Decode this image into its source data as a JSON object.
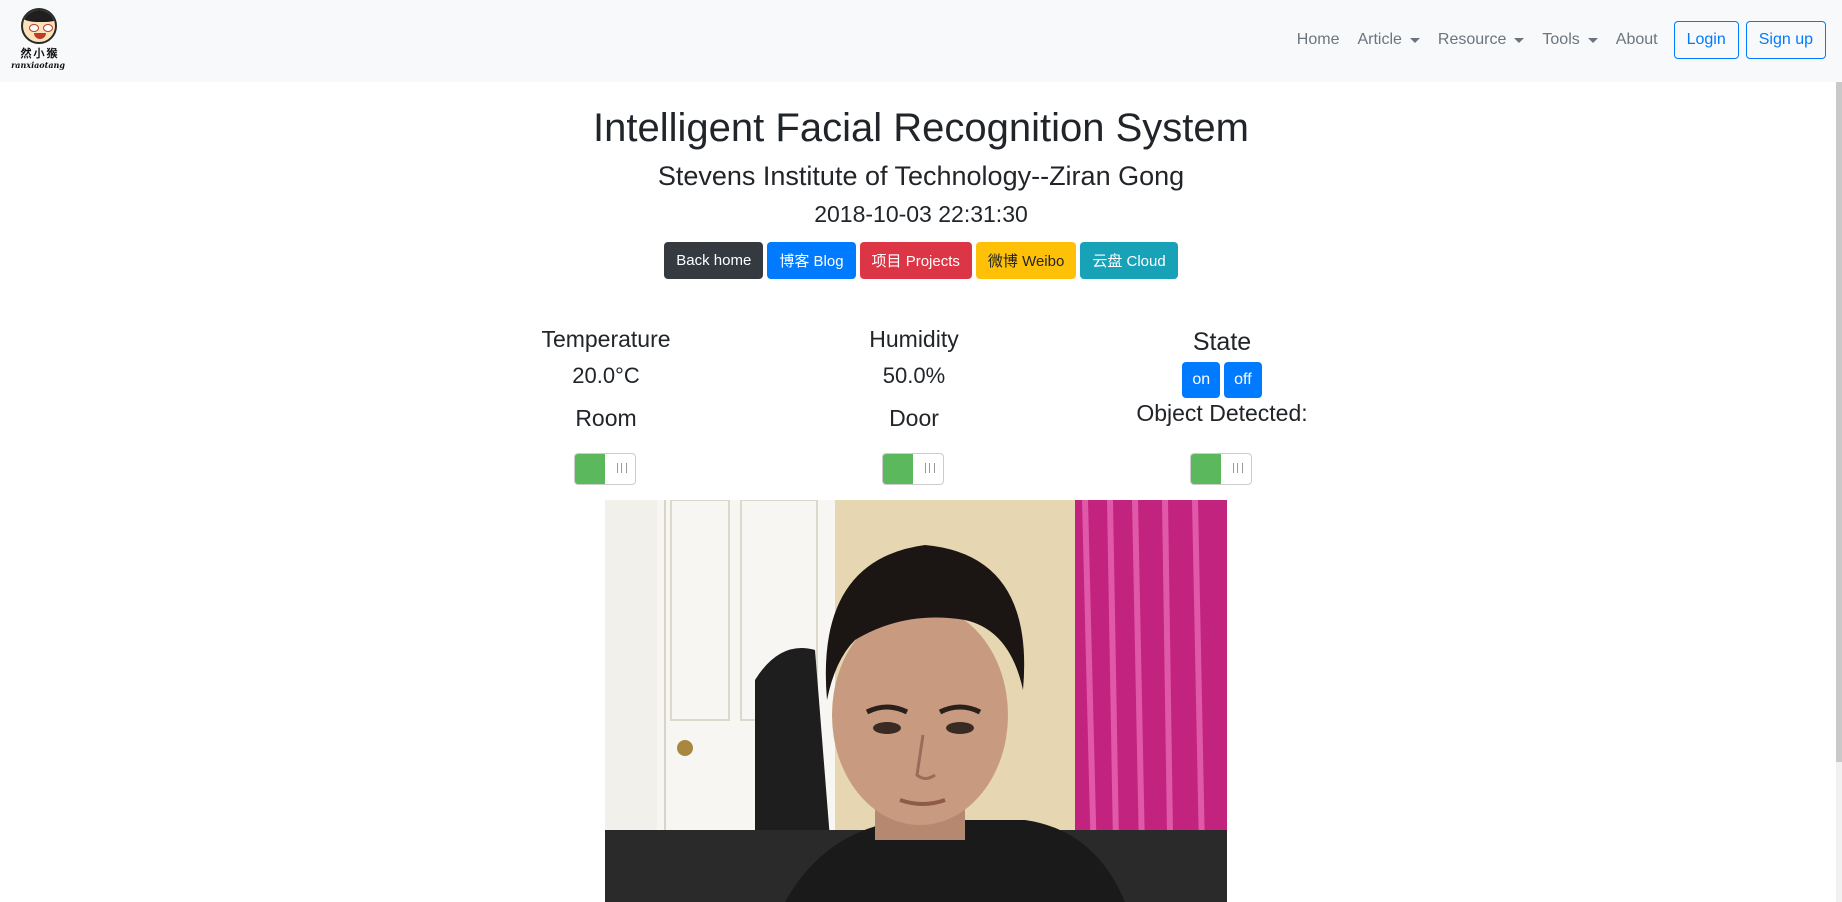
{
  "navbar": {
    "brand": {
      "cn_text": "然小猴",
      "en_text": "ranxiaotang"
    },
    "links": [
      {
        "label": "Home",
        "dropdown": false
      },
      {
        "label": "Article",
        "dropdown": true
      },
      {
        "label": "Resource",
        "dropdown": true
      },
      {
        "label": "Tools",
        "dropdown": true
      },
      {
        "label": "About",
        "dropdown": false
      }
    ],
    "login_label": "Login",
    "signup_label": "Sign up"
  },
  "header": {
    "title": "Intelligent Facial Recognition System",
    "subtitle": "Stevens Institute of Technology--Ziran Gong",
    "datetime": "2018-10-03 22:31:30"
  },
  "buttons": [
    {
      "label": "Back home",
      "color": "#343a40"
    },
    {
      "label": "博客 Blog",
      "color": "#007bff"
    },
    {
      "label": "项目 Projects",
      "color": "#dc3545"
    },
    {
      "label": "微博 Weibo",
      "color": "#ffc107"
    },
    {
      "label": "云盘 Cloud",
      "color": "#17a2b8"
    }
  ],
  "sensors": {
    "temperature": {
      "label": "Temperature",
      "value": "20.0°C"
    },
    "humidity": {
      "label": "Humidity",
      "value": "50.0%"
    },
    "state": {
      "label": "State",
      "on_label": "on",
      "off_label": "off"
    }
  },
  "toggles": {
    "room": {
      "label": "Room",
      "on": true
    },
    "door": {
      "label": "Door",
      "on": true
    },
    "object": {
      "label": "Object Detected:",
      "on": true
    }
  },
  "colors": {
    "toggle_on": "#5cb85c",
    "primary": "#007bff",
    "navbar_bg": "#f8f9fa"
  }
}
